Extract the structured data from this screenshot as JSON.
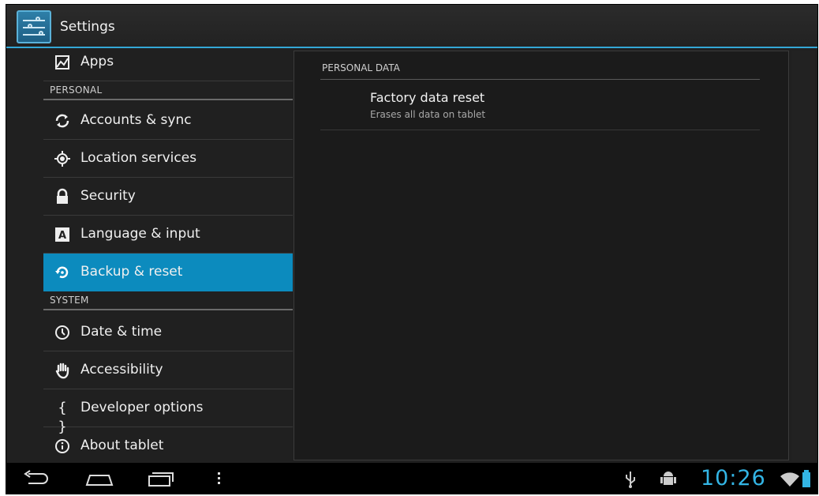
{
  "action_bar": {
    "title": "Settings"
  },
  "sidebar": {
    "items": [
      {
        "label": "Apps",
        "icon": "apps-icon"
      },
      {
        "label": "Accounts & sync",
        "icon": "sync-icon"
      },
      {
        "label": "Location services",
        "icon": "location-icon"
      },
      {
        "label": "Security",
        "icon": "lock-icon"
      },
      {
        "label": "Language & input",
        "icon": "language-icon"
      },
      {
        "label": "Backup & reset",
        "icon": "backup-icon",
        "selected": true
      },
      {
        "label": "Date & time",
        "icon": "clock-icon"
      },
      {
        "label": "Accessibility",
        "icon": "hand-icon"
      },
      {
        "label": "Developer options",
        "icon": "braces-icon"
      },
      {
        "label": "About tablet",
        "icon": "info-icon"
      }
    ],
    "headers": {
      "personal": "PERSONAL",
      "system": "SYSTEM"
    }
  },
  "detail": {
    "header": "PERSONAL DATA",
    "pref": {
      "title": "Factory data reset",
      "summary": "Erases all data on tablet"
    }
  },
  "status_bar": {
    "time": "10:26"
  },
  "colors": {
    "accent": "#33b5e5",
    "selected": "#0c8bbe",
    "background": "#202020"
  }
}
